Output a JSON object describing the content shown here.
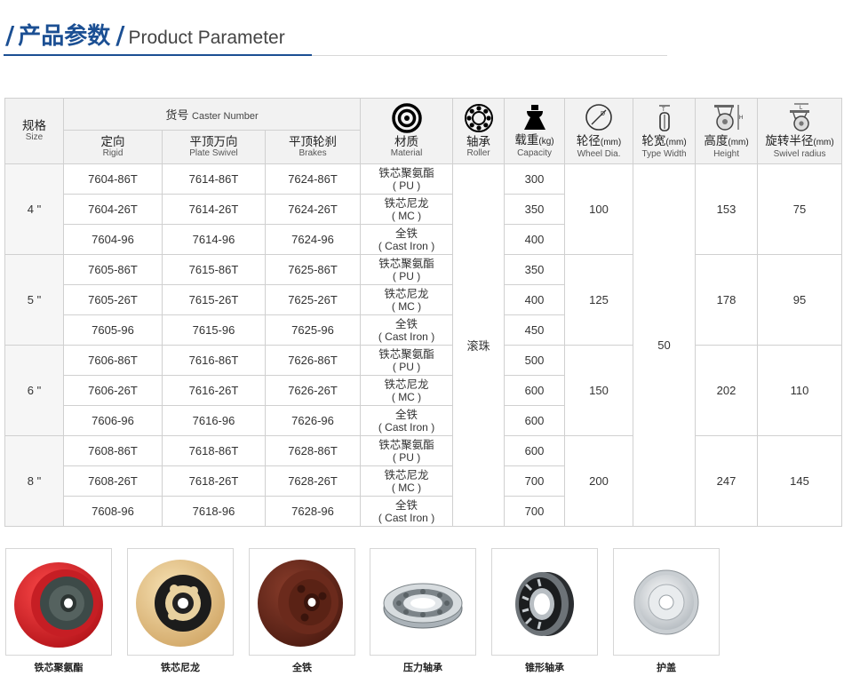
{
  "title": {
    "zh": "产品参数",
    "en": "Product Parameter"
  },
  "header": {
    "size": {
      "zh": "规格",
      "en": "Size"
    },
    "caster_number": {
      "zh": "货号",
      "en": "Caster Number"
    },
    "rigid": {
      "zh": "定向",
      "en": "Rigid"
    },
    "plate_swivel": {
      "zh": "平顶万向",
      "en": "Plate Swivel"
    },
    "brakes": {
      "zh": "平顶轮刹",
      "en": "Brakes"
    },
    "material": {
      "zh": "材质",
      "en": "Material"
    },
    "roller": {
      "zh": "轴承",
      "en": "Roller"
    },
    "capacity": {
      "zh": "载重",
      "unit": "(kg)",
      "en": "Capacity"
    },
    "wheel_dia": {
      "zh": "轮径",
      "unit": "(mm)",
      "en": "Wheel Dia."
    },
    "type_width": {
      "zh": "轮宽",
      "unit": "(mm)",
      "en": "Type Width"
    },
    "height": {
      "zh": "高度",
      "unit": "(mm)",
      "en": "Height"
    },
    "swivel_radius": {
      "zh": "旋转半径",
      "unit": "(mm)",
      "en": "Swivel radius"
    }
  },
  "materials": {
    "pu": {
      "zh": "铁芯聚氨酯",
      "en": "( PU )"
    },
    "mc": {
      "zh": "铁芯尼龙",
      "en": "( MC )"
    },
    "iron": {
      "zh": "全铁",
      "en": "( Cast Iron )"
    }
  },
  "roller_value": "滚珠",
  "width_value": "50",
  "groups": [
    {
      "size": "4 \"",
      "wheel_dia": "100",
      "height": "153",
      "swivel_radius": "75",
      "rows": [
        {
          "rigid": "7604-86T",
          "swivel": "7614-86T",
          "brake": "7624-86T",
          "capacity": "300"
        },
        {
          "rigid": "7604-26T",
          "swivel": "7614-26T",
          "brake": "7624-26T",
          "capacity": "350"
        },
        {
          "rigid": "7604-96",
          "swivel": "7614-96",
          "brake": "7624-96",
          "capacity": "400"
        }
      ]
    },
    {
      "size": "5 \"",
      "wheel_dia": "125",
      "height": "178",
      "swivel_radius": "95",
      "rows": [
        {
          "rigid": "7605-86T",
          "swivel": "7615-86T",
          "brake": "7625-86T",
          "capacity": "350"
        },
        {
          "rigid": "7605-26T",
          "swivel": "7615-26T",
          "brake": "7625-26T",
          "capacity": "400"
        },
        {
          "rigid": "7605-96",
          "swivel": "7615-96",
          "brake": "7625-96",
          "capacity": "450"
        }
      ]
    },
    {
      "size": "6 \"",
      "wheel_dia": "150",
      "height": "202",
      "swivel_radius": "110",
      "rows": [
        {
          "rigid": "7606-86T",
          "swivel": "7616-86T",
          "brake": "7626-86T",
          "capacity": "500"
        },
        {
          "rigid": "7606-26T",
          "swivel": "7616-26T",
          "brake": "7626-26T",
          "capacity": "600"
        },
        {
          "rigid": "7606-96",
          "swivel": "7616-96",
          "brake": "7626-96",
          "capacity": "600"
        }
      ]
    },
    {
      "size": "8 \"",
      "wheel_dia": "200",
      "height": "247",
      "swivel_radius": "145",
      "rows": [
        {
          "rigid": "7608-86T",
          "swivel": "7618-86T",
          "brake": "7628-86T",
          "capacity": "600"
        },
        {
          "rigid": "7608-26T",
          "swivel": "7618-26T",
          "brake": "7628-26T",
          "capacity": "700"
        },
        {
          "rigid": "7608-96",
          "swivel": "7618-96",
          "brake": "7628-96",
          "capacity": "700"
        }
      ]
    }
  ],
  "products": [
    {
      "label": "铁芯聚氨酯",
      "icon": "red-pu-wheel-image"
    },
    {
      "label": "铁芯尼龙",
      "icon": "nylon-wheel-image"
    },
    {
      "label": "全铁",
      "icon": "cast-iron-wheel-image"
    },
    {
      "label": "压力轴承",
      "icon": "thrust-bearing-image"
    },
    {
      "label": "锥形轴承",
      "icon": "tapered-bearing-image"
    },
    {
      "label": "护盖",
      "icon": "dust-cover-image"
    }
  ],
  "colors": {
    "accent": "#1b4f93",
    "pu": "#d8262c",
    "nylon": "#e3c38a",
    "iron": "#6b2a1c"
  }
}
